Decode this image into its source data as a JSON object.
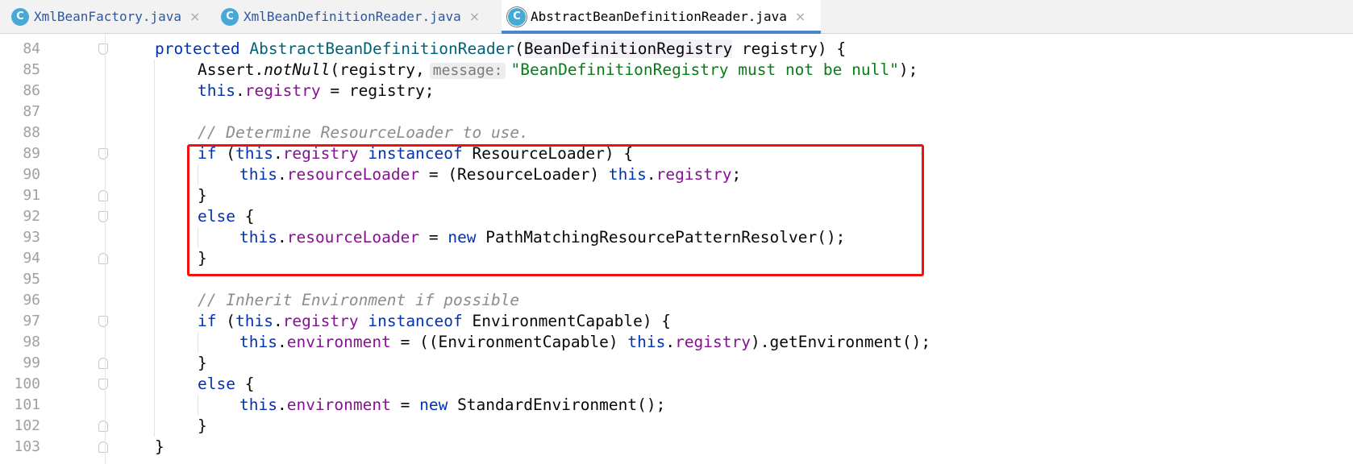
{
  "tabs": [
    {
      "icon": "C",
      "name": "XmlBeanFactory.java",
      "close": "×"
    },
    {
      "icon": "C",
      "name": "XmlBeanDefinitionReader.java",
      "close": "×"
    },
    {
      "icon": "C",
      "name": "AbstractBeanDefinitionReader.java",
      "close": "×"
    }
  ],
  "editor": {
    "line_numbers": [
      "84",
      "85",
      "86",
      "87",
      "88",
      "89",
      "90",
      "91",
      "92",
      "93",
      "94",
      "95",
      "96",
      "97",
      "98",
      "99",
      "100",
      "101",
      "102",
      "103"
    ],
    "lines": {
      "l84": {
        "kw": "protected",
        "fn": "AbstractBeanDefinitionReader",
        "open": "(",
        "type": "BeanDefinitionRegistry",
        "rest": " registry) {"
      },
      "l85": {
        "pre": "Assert.",
        "fn": "notNull",
        "mid": "(registry,",
        "hint": "message:",
        "str": "\"BeanDefinitionRegistry must not be null\"",
        "end": ");"
      },
      "l86": {
        "kw": "this",
        "dot": ".",
        "fd": "registry",
        "rest": " = registry;"
      },
      "l88": {
        "comment": "// Determine ResourceLoader to use."
      },
      "l89": {
        "kw1": "if",
        "p1": " (",
        "kw2": "this",
        "dot": ".",
        "fd": "registry",
        "sp": " ",
        "kw3": "instanceof",
        "rest": " ResourceLoader) {"
      },
      "l90": {
        "kw1": "this",
        "dot": ".",
        "fd": "resourceLoader",
        "mid": " = (ResourceLoader) ",
        "kw2": "this",
        "dot2": ".",
        "fd2": "registry",
        "end": ";"
      },
      "l91": {
        "text": "}"
      },
      "l92": {
        "kw": "else",
        "rest": " {"
      },
      "l93": {
        "kw1": "this",
        "dot": ".",
        "fd": "resourceLoader",
        "mid": " = ",
        "kw2": "new",
        "rest": " PathMatchingResourcePatternResolver();"
      },
      "l94": {
        "text": "}"
      },
      "l96": {
        "comment": "// Inherit Environment if possible"
      },
      "l97": {
        "kw1": "if",
        "p1": " (",
        "kw2": "this",
        "dot": ".",
        "fd": "registry",
        "sp": " ",
        "kw3": "instanceof",
        "rest": " EnvironmentCapable) {"
      },
      "l98": {
        "kw1": "this",
        "dot": ".",
        "fd": "environment",
        "mid": " = ((EnvironmentCapable) ",
        "kw2": "this",
        "dot2": ".",
        "fd2": "registry",
        "end": ").getEnvironment();"
      },
      "l99": {
        "text": "}"
      },
      "l100": {
        "kw": "else",
        "rest": " {"
      },
      "l101": {
        "kw1": "this",
        "dot": ".",
        "fd": "environment",
        "mid": " = ",
        "kw2": "new",
        "rest": " StandardEnvironment();"
      },
      "l102": {
        "text": "}"
      },
      "l103": {
        "text": "}"
      }
    }
  },
  "colors": {
    "keyword": "#0033b3",
    "method": "#00627a",
    "field": "#871094",
    "string": "#067d17",
    "comment": "#8c8c8c",
    "highlight_box": "#f01010",
    "tab_accent": "#4a86c8",
    "class_icon": "#46a9d6"
  }
}
